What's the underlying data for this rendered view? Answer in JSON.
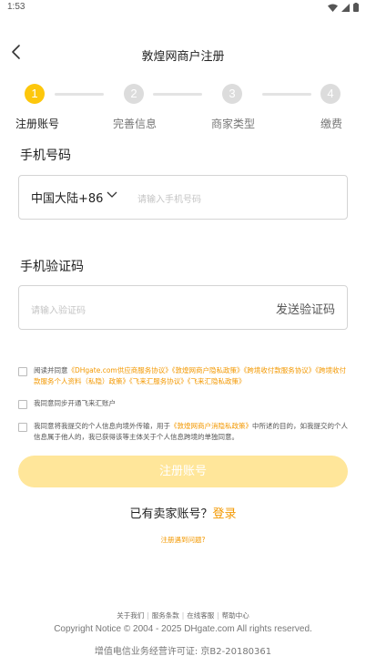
{
  "status_bar": {
    "time": "1:53"
  },
  "header": {
    "title": "敦煌网商户注册"
  },
  "steps": [
    {
      "number": "1",
      "label": "注册账号"
    },
    {
      "number": "2",
      "label": "完善信息"
    },
    {
      "number": "3",
      "label": "商家类型"
    },
    {
      "number": "4",
      "label": "缴费"
    }
  ],
  "phone": {
    "label": "手机号码",
    "country": "中国大陆+86",
    "placeholder": "请输入手机号码"
  },
  "code": {
    "label": "手机验证码",
    "placeholder": "请输入验证码",
    "send_label": "发送验证码"
  },
  "agreements": {
    "a1_prefix": "阅读并同意",
    "a1_links": [
      "《DHgate.com供应商服务协议》",
      "《敦煌网商户隐私政策》",
      "《跨境收付款服务协议》",
      "《跨境收付款服务个人资料（私隐）政策》",
      "《飞来汇服务协议》",
      "《飞来汇隐私政策》"
    ],
    "a2_text": "我同意同步开通飞来汇账户",
    "a3_prefix": "我同意将我提交的个人信息向境外传输，用于",
    "a3_link": "《敦煌网商户消隐私政策》",
    "a3_suffix": "中所述的目的，如我提交的个人信息属于他人的，我已获得该等主体关于个人信息跨境的单独同意。"
  },
  "register_button": "注册账号",
  "login": {
    "prompt": "已有卖家账号？",
    "link": "登录"
  },
  "problem_link": "注册遇到问题?",
  "footer": {
    "links": [
      "关于我们",
      "服务条款",
      "在线客服",
      "帮助中心"
    ],
    "copyright": "Copyright Notice © 2004 - 2025 DHgate.com All rights reserved.",
    "license": "增值电信业务经营许可证: 京B2-20180361"
  },
  "colors": {
    "accent": "#f39800",
    "active_step": "#fdc70c",
    "inactive_step": "#dcdcdc",
    "button_disabled": "#ffe69a"
  }
}
